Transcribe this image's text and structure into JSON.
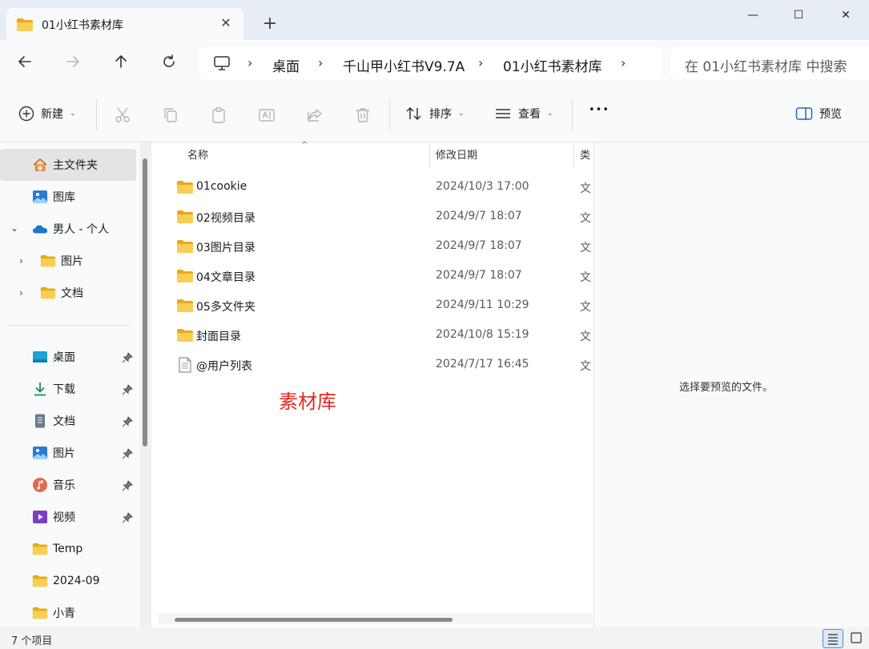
{
  "window": {
    "tab_title": "01小红书素材库",
    "close_tab_symbol": "✕",
    "new_tab_symbol": "+",
    "minimize_symbol": "—",
    "maximize_symbol": "☐",
    "close_symbol": "✕"
  },
  "address": {
    "crumbs": [
      "桌面",
      "千山甲小红书V9.7A",
      "01小红书素材库"
    ],
    "search_placeholder": "在 01小红书素材库 中搜索"
  },
  "toolbar": {
    "new_label": "新建",
    "sort_label": "排序",
    "view_label": "查看",
    "more_label": "•••",
    "preview_label": "预览"
  },
  "sidebar": {
    "top_items": [
      {
        "label": "主文件夹",
        "icon": "home-icon",
        "selected": true
      },
      {
        "label": "图库",
        "icon": "gallery-icon"
      },
      {
        "label": "男人 - 个人",
        "icon": "onedrive-icon"
      },
      {
        "label": "图片",
        "icon": "folder-icon"
      },
      {
        "label": "文档",
        "icon": "folder-icon"
      }
    ],
    "quick_items": [
      {
        "label": "桌面",
        "icon": "desktop-icon",
        "pinned": true
      },
      {
        "label": "下载",
        "icon": "download-icon",
        "pinned": true
      },
      {
        "label": "文档",
        "icon": "document-icon",
        "pinned": true
      },
      {
        "label": "图片",
        "icon": "pictures-icon",
        "pinned": true
      },
      {
        "label": "音乐",
        "icon": "music-icon",
        "pinned": true
      },
      {
        "label": "视频",
        "icon": "video-icon",
        "pinned": true
      },
      {
        "label": "Temp",
        "icon": "folder-icon",
        "pinned": false
      },
      {
        "label": "2024-09",
        "icon": "folder-icon",
        "pinned": false
      },
      {
        "label": "小青",
        "icon": "folder-icon",
        "pinned": false
      }
    ]
  },
  "filelist": {
    "columns": [
      "名称",
      "修改日期",
      "类"
    ],
    "rows": [
      {
        "name": "01cookie",
        "date": "2024/10/3 17:00",
        "type": "文",
        "kind": "folder"
      },
      {
        "name": "02视频目录",
        "date": "2024/9/7 18:07",
        "type": "文",
        "kind": "folder"
      },
      {
        "name": "03图片目录",
        "date": "2024/9/7 18:07",
        "type": "文",
        "kind": "folder"
      },
      {
        "name": "04文章目录",
        "date": "2024/9/7 18:07",
        "type": "文",
        "kind": "folder"
      },
      {
        "name": "05多文件夹",
        "date": "2024/9/11 10:29",
        "type": "文",
        "kind": "folder"
      },
      {
        "name": "封面目录",
        "date": "2024/10/8 15:19",
        "type": "文",
        "kind": "folder"
      },
      {
        "name": "@用户列表",
        "date": "2024/7/17 16:45",
        "type": "文",
        "kind": "file"
      }
    ],
    "annotation": "素材库"
  },
  "preview": {
    "empty_text": "选择要预览的文件。"
  },
  "status": {
    "item_count": "7 个项目"
  },
  "colors": {
    "folder": "#f5c445",
    "accent": "#0067c0",
    "annotation": "#e12a24"
  }
}
